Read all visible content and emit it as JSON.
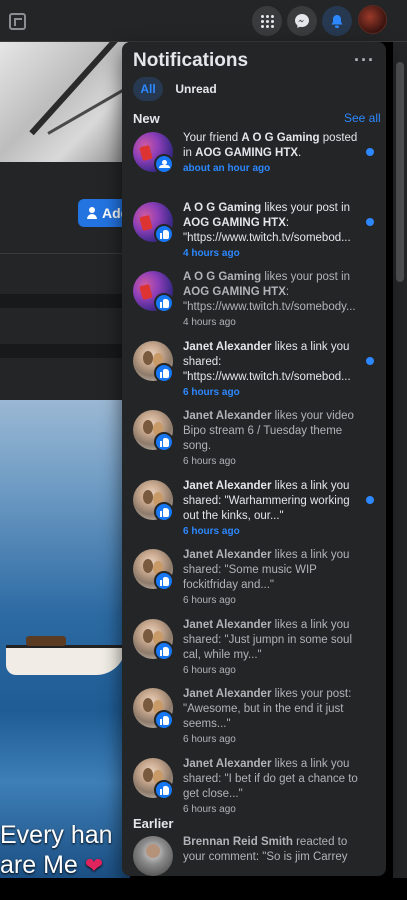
{
  "header": {
    "icons": [
      "app-logo-icon",
      "apps-grid-icon",
      "messenger-icon",
      "bell-icon",
      "profile-avatar"
    ]
  },
  "background_page": {
    "add_button_label": "Add",
    "caption_line1": "Every han",
    "caption_line2": "are Me"
  },
  "notifications": {
    "title": "Notifications",
    "more_label": "···",
    "tabs": [
      {
        "label": "All",
        "active": true
      },
      {
        "label": "Unread",
        "active": false
      }
    ],
    "sections": {
      "new_label": "New",
      "see_all_label": "See all",
      "earlier_label": "Earlier"
    },
    "items": [
      {
        "pre": "Your friend ",
        "actor": "A O G Gaming",
        "mid": " posted in ",
        "target": "AOG GAMING HTX",
        "post": ".",
        "time": "about an hour ago",
        "unread": true,
        "badge": "group",
        "avatar": "aog"
      },
      {
        "pre": "",
        "actor": "A O G Gaming",
        "mid": " likes your post in ",
        "target": "AOG GAMING HTX",
        "post": ": \"https://www.twitch.tv/somebod...",
        "time": "4 hours ago",
        "unread": true,
        "badge": "like",
        "avatar": "aog"
      },
      {
        "pre": "",
        "actor": "A O G Gaming",
        "mid": " likes your post in ",
        "target": "AOG GAMING HTX",
        "post": ": \"https://www.twitch.tv/somebody...",
        "time": "4 hours ago",
        "unread": false,
        "badge": "like",
        "avatar": "aog"
      },
      {
        "pre": "",
        "actor": "Janet Alexander",
        "mid": " likes a link you shared: \"https://www.twitch.tv/somebod...",
        "target": "",
        "post": "",
        "time": "6 hours ago",
        "unread": true,
        "badge": "like",
        "avatar": "janet"
      },
      {
        "pre": "",
        "actor": "Janet Alexander",
        "mid": " likes your video Bipo stream 6 / Tuesday theme song.",
        "target": "",
        "post": "",
        "time": "6 hours ago",
        "unread": false,
        "badge": "like",
        "avatar": "janet"
      },
      {
        "pre": "",
        "actor": "Janet Alexander",
        "mid": " likes a link you shared: \"Warhammering working out the kinks, our...\"",
        "target": "",
        "post": "",
        "time": "6 hours ago",
        "unread": true,
        "badge": "like",
        "avatar": "janet"
      },
      {
        "pre": "",
        "actor": "Janet Alexander",
        "mid": " likes a link you shared: \"Some music WIP fockitfriday and...\"",
        "target": "",
        "post": "",
        "time": "6 hours ago",
        "unread": false,
        "badge": "like",
        "avatar": "janet"
      },
      {
        "pre": "",
        "actor": "Janet Alexander",
        "mid": " likes a link you shared: \"Just jumpn in some soul cal, while my...\"",
        "target": "",
        "post": "",
        "time": "6 hours ago",
        "unread": false,
        "badge": "like",
        "avatar": "janet"
      },
      {
        "pre": "",
        "actor": "Janet Alexander",
        "mid": " likes your post: \"Awesome, but in the end it just seems...\"",
        "target": "",
        "post": "",
        "time": "6 hours ago",
        "unread": false,
        "badge": "like",
        "avatar": "janet"
      },
      {
        "pre": "",
        "actor": "Janet Alexander",
        "mid": " likes a link you shared: \"I bet if do get a chance to get close...\"",
        "target": "",
        "post": "",
        "time": "6 hours ago",
        "unread": false,
        "badge": "like",
        "avatar": "janet"
      }
    ],
    "earlier_items": [
      {
        "actor": "Brennan Reid Smith",
        "mid": " reacted to your comment: \"So is jim Carrey",
        "avatar": "brennan"
      }
    ]
  },
  "colors": {
    "accent": "#2d88ff",
    "panel_bg": "#242526",
    "unread_dot": "#2d88ff"
  }
}
